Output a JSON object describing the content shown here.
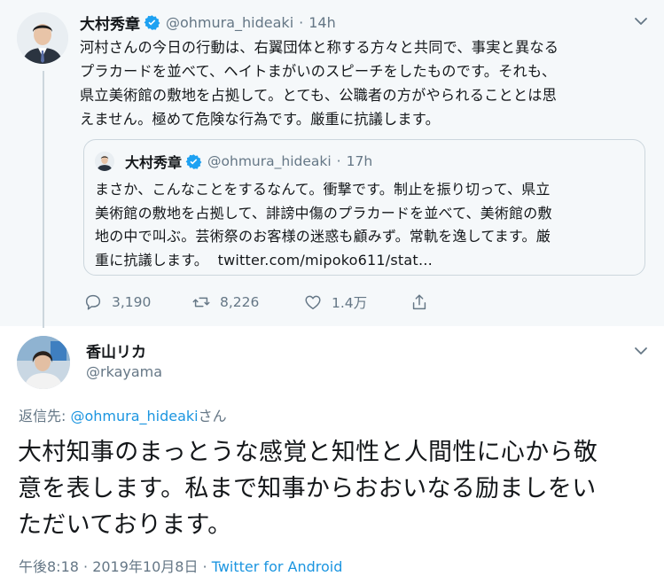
{
  "colors": {
    "link": "#1b95e0",
    "muted": "#657786",
    "verified": "#1da1f2",
    "parent_bg": "#f5f8fa"
  },
  "parent_tweet": {
    "name": "大村秀章",
    "handle": "@ohmura_hideaki",
    "dot": "·",
    "time": "14h",
    "verified_icon": "verified-badge-icon",
    "text_lines": [
      "河村さんの今日の行動は、右翼団体と称する方々と共同で、事実と異なる",
      "プラカードを並べて、ヘイトまがいのスピーチをしたものです。それも、",
      "県立美術館の敷地を占拠して。とても、公職者の方がやられることとは思",
      "えません。極めて危険な行為です。厳重に抗議します。"
    ],
    "quote": {
      "name": "大村秀章",
      "handle": "@ohmura_hideaki",
      "dot": "·",
      "time": "17h",
      "text_lines": [
        "まさか、こんなことをするなんて。衝撃です。制止を振り切って、県立",
        "美術館の敷地を占拠して、誹謗中傷のプラカードを並べて、美術館の敷",
        "地の中で叫ぶ。芸術祭のお客様の迷惑も顧みず。常軌を逸してます。厳"
      ],
      "last_line_text": "重に抗議します。",
      "link": "twitter.com/mipoko611/stat…"
    },
    "actions": {
      "reply_count": "3,190",
      "retweet_count": "8,226",
      "like_count": "1.4万"
    }
  },
  "reply_tweet": {
    "name": "香山リカ",
    "handle": "@rkayama",
    "replying_prefix": "返信先: ",
    "replying_mention": "@ohmura_hideaki",
    "replying_suffix": "さん",
    "text_lines": [
      "大村知事のまっとうな感覚と知性と人間性に心から敬",
      "意を表します。私まで知事からおおいなる励ましをい",
      "ただいております。"
    ],
    "timestamp": "午後8:18 · 2019年10月8日",
    "sep": " · ",
    "source": "Twitter for Android"
  }
}
